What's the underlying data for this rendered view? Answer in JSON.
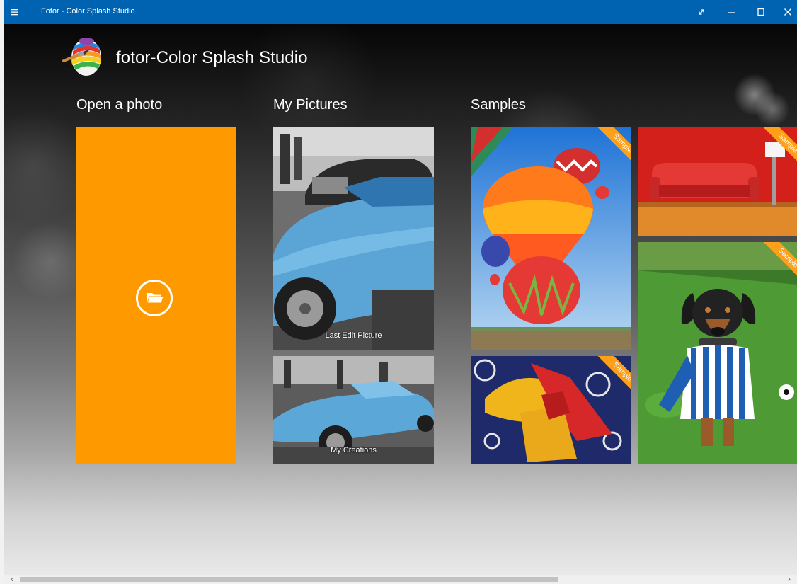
{
  "window": {
    "title": "Fotor - Color Splash Studio",
    "accent_color": "#0063b1"
  },
  "app": {
    "name": "fotor-Color Splash Studio",
    "logo_icon": "paintbrush-egg-logo"
  },
  "sections": {
    "open_photo": {
      "heading": "Open a photo",
      "tile_color": "#ff9900",
      "icon": "folder-icon"
    },
    "my_pictures": {
      "heading": "My Pictures",
      "items": [
        {
          "caption": "Last Edit Picture"
        },
        {
          "caption": "My Creations"
        }
      ]
    },
    "samples": {
      "heading": "Samples",
      "badge": "Sample",
      "items": [
        {
          "subject": "hot-air-balloons"
        },
        {
          "subject": "red-sofa"
        },
        {
          "subject": "fabric-bow"
        },
        {
          "subject": "dog-in-striped-shirt"
        }
      ]
    }
  },
  "scrollbar": {
    "left_arrow": "‹",
    "right_arrow": "›"
  }
}
